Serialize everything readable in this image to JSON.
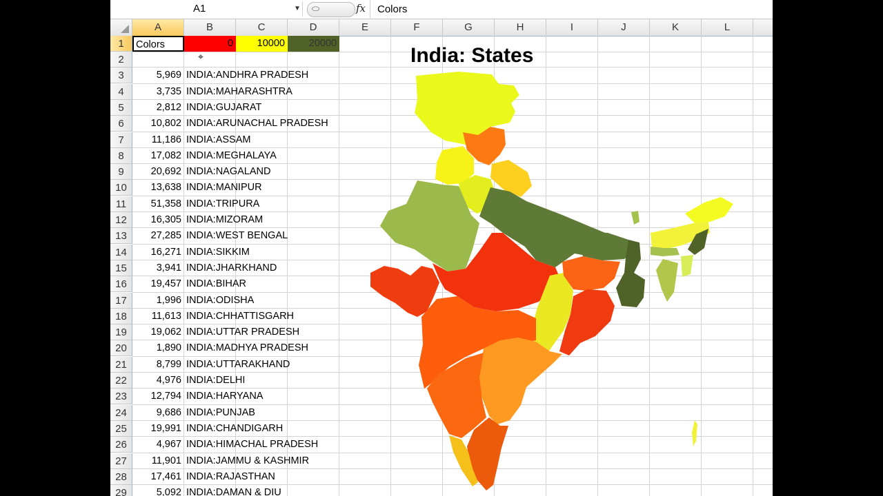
{
  "formula_bar": {
    "name_box": "A1",
    "fx_label": "fx",
    "value": "Colors"
  },
  "columns": [
    "A",
    "B",
    "C",
    "D",
    "E",
    "F",
    "G",
    "H",
    "I",
    "J",
    "K",
    "L"
  ],
  "row1": {
    "a": "Colors",
    "b": "0",
    "c": "10000",
    "d": "20000"
  },
  "map_title": "India: States",
  "rows": [
    {
      "n": "2",
      "value": "",
      "label": ""
    },
    {
      "n": "3",
      "value": "5,969",
      "label": "INDIA:ANDHRA PRADESH"
    },
    {
      "n": "4",
      "value": "3,735",
      "label": "INDIA:MAHARASHTRA"
    },
    {
      "n": "5",
      "value": "2,812",
      "label": "INDIA:GUJARAT"
    },
    {
      "n": "6",
      "value": "10,802",
      "label": "INDIA:ARUNACHAL PRADESH"
    },
    {
      "n": "7",
      "value": "11,186",
      "label": "INDIA:ASSAM"
    },
    {
      "n": "8",
      "value": "17,082",
      "label": "INDIA:MEGHALAYA"
    },
    {
      "n": "9",
      "value": "20,692",
      "label": "INDIA:NAGALAND"
    },
    {
      "n": "10",
      "value": "13,638",
      "label": "INDIA:MANIPUR"
    },
    {
      "n": "11",
      "value": "51,358",
      "label": "INDIA:TRIPURA"
    },
    {
      "n": "12",
      "value": "16,305",
      "label": "INDIA:MIZORAM"
    },
    {
      "n": "13",
      "value": "27,285",
      "label": "INDIA:WEST BENGAL"
    },
    {
      "n": "14",
      "value": "16,271",
      "label": "INDIA:SIKKIM"
    },
    {
      "n": "15",
      "value": "3,941",
      "label": "INDIA:JHARKHAND"
    },
    {
      "n": "16",
      "value": "19,457",
      "label": "INDIA:BIHAR"
    },
    {
      "n": "17",
      "value": "1,996",
      "label": "INDIA:ODISHA"
    },
    {
      "n": "18",
      "value": "11,613",
      "label": "INDIA:CHHATTISGARH"
    },
    {
      "n": "19",
      "value": "19,062",
      "label": "INDIA:UTTAR PRADESH"
    },
    {
      "n": "20",
      "value": "1,890",
      "label": "INDIA:MADHYA PRADESH"
    },
    {
      "n": "21",
      "value": "8,799",
      "label": "INDIA:UTTARAKHAND"
    },
    {
      "n": "22",
      "value": "4,976",
      "label": "INDIA:DELHI"
    },
    {
      "n": "23",
      "value": "12,794",
      "label": "INDIA:HARYANA"
    },
    {
      "n": "24",
      "value": "9,686",
      "label": "INDIA:PUNJAB"
    },
    {
      "n": "25",
      "value": "19,991",
      "label": "INDIA:CHANDIGARH"
    },
    {
      "n": "26",
      "value": "4,967",
      "label": "INDIA:HIMACHAL PRADESH"
    },
    {
      "n": "27",
      "value": "11,901",
      "label": "INDIA:JAMMU & KASHMIR"
    },
    {
      "n": "28",
      "value": "17,461",
      "label": "INDIA:RAJASTHAN"
    },
    {
      "n": "29",
      "value": "5,092",
      "label": "INDIA:DAMAN & DIU"
    }
  ],
  "colors": {
    "low": "#ff0000",
    "mid": "#ffff00",
    "high": "#4f6228",
    "selection": "#f9c95e"
  }
}
